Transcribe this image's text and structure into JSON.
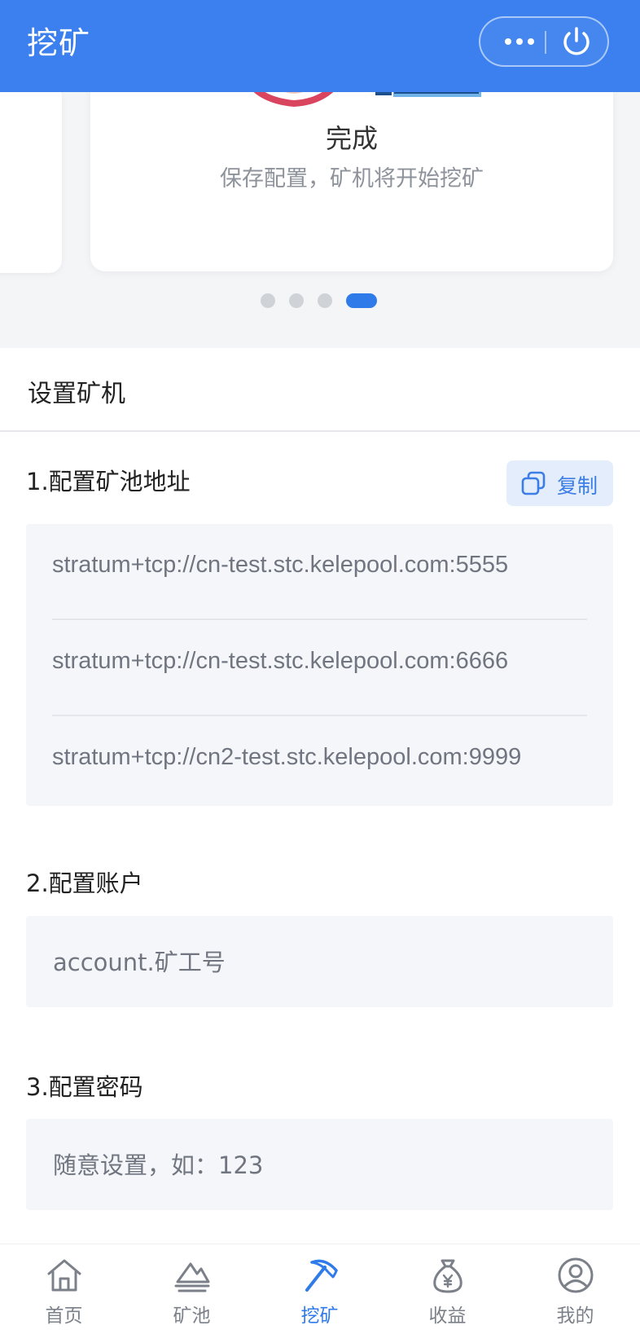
{
  "header": {
    "title": "挖矿"
  },
  "carousel": {
    "card_title": "完成",
    "card_subtitle": "保存配置，矿机将开始挖矿",
    "page_count": 4,
    "active_index": 3
  },
  "setup": {
    "title": "设置矿机",
    "pool": {
      "label": "1.配置矿池地址",
      "copy_label": "复制",
      "addresses": [
        "stratum+tcp://cn-test.stc.kelepool.com:5555",
        "stratum+tcp://cn-test.stc.kelepool.com:6666",
        "stratum+tcp://cn2-test.stc.kelepool.com:9999"
      ]
    },
    "account": {
      "label": "2.配置账户",
      "value": "account.矿工号"
    },
    "password": {
      "label": "3.配置密码",
      "value": "随意设置，如：123"
    }
  },
  "tabbar": {
    "tabs": [
      {
        "label": "首页",
        "icon": "home-icon"
      },
      {
        "label": "矿池",
        "icon": "mountain-icon"
      },
      {
        "label": "挖矿",
        "icon": "pickaxe-icon",
        "active": true
      },
      {
        "label": "收益",
        "icon": "money-bag-icon"
      },
      {
        "label": "我的",
        "icon": "user-icon"
      }
    ]
  },
  "colors": {
    "brand": "#3b80ee",
    "active_tab": "#2f7bea",
    "copy_bg": "#e3edfb"
  }
}
